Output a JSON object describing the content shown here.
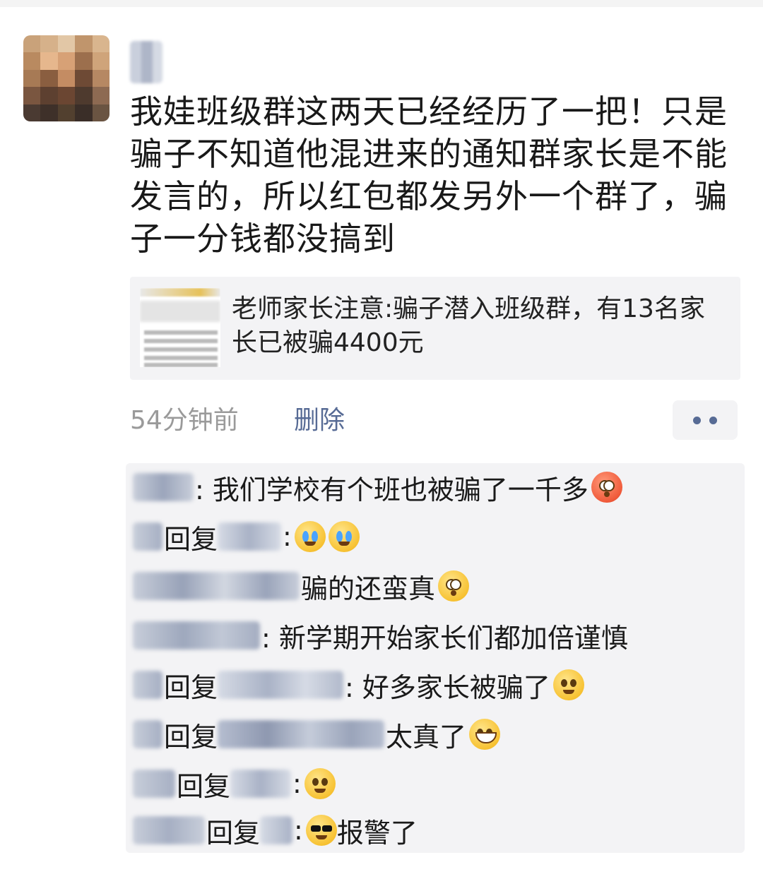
{
  "post": {
    "text": "我娃班级群这两天已经经历了一把！只是骗子不知道他混进来的通知群家长是不能发言的，所以红包都发另外一个群了，骗子一分钱都没搞到",
    "link_card": {
      "title": "老师家长注意:骗子潜入班级群，有13名家长已被骗4400元",
      "thumb_lines": [
        "班成员 九月一号开学了,",
        "学生成绩下降了很多,",
        "一数学习资料,一共",
        "主要是学习语数外这",
        "资料费共计200元"
      ]
    },
    "time": "54分钟前",
    "delete_label": "删除",
    "more_icon": "more-dots-icon"
  },
  "comments": [
    {
      "type": "comment",
      "text": ": 我们学校有个班也被骗了一千多",
      "emoji": "flushed-red"
    },
    {
      "type": "reply",
      "reply_word": "回复",
      "text": ": ",
      "emoji": "facepalm-cry x2"
    },
    {
      "type": "comment",
      "text": "骗的还蛮真",
      "emoji": "wide-eyes"
    },
    {
      "type": "comment",
      "text": ": 新学期开始家长们都加倍谨慎",
      "emoji": ""
    },
    {
      "type": "reply",
      "reply_word": "回复",
      "text": ": 好多家长被骗了",
      "emoji": "pleading"
    },
    {
      "type": "reply",
      "reply_word": "回复",
      "text": "太真了",
      "emoji": "grin"
    },
    {
      "type": "reply",
      "reply_word": "回复",
      "text": ": ",
      "emoji": "pleading"
    },
    {
      "type": "reply",
      "reply_word": "回复",
      "text": ": 报警了",
      "emoji": "cool"
    }
  ]
}
